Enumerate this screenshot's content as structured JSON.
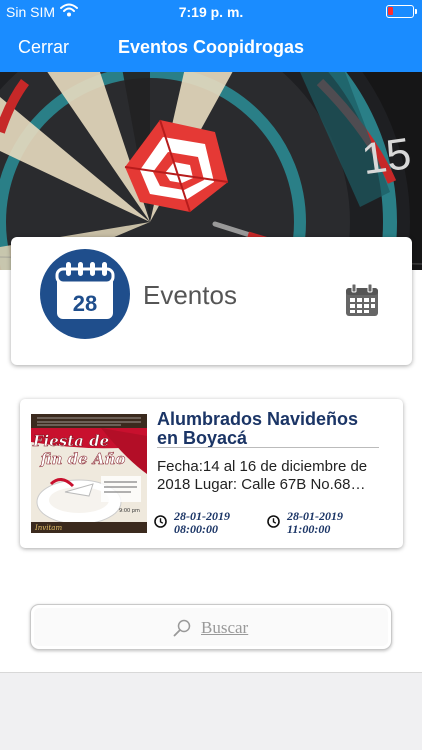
{
  "status_bar": {
    "carrier": "Sin SIM",
    "time": "7:19 p. m.",
    "wifi_icon": "wifi-icon",
    "battery_icon": "battery-low-icon",
    "battery_level": 0.15,
    "battery_color": "#ff2d2d"
  },
  "nav": {
    "close_label": "Cerrar",
    "title": "Eventos Coopidrogas",
    "color": "#1a8cff"
  },
  "hero": {
    "image": "darts-board-photo",
    "board_number": "15"
  },
  "header_card": {
    "icon_day": "28",
    "label": "Eventos",
    "calendar_icon": "calendar-icon"
  },
  "events": [
    {
      "title": "Alumbrados Navideños en Boyacá",
      "description": "Fecha:14 al 16 de diciembre de 2018 Lugar: Calle 67B No.68…",
      "thumb_title_line1": "Fiesta de",
      "thumb_title_line2": "fin de Año",
      "start_date": "28-01-2019",
      "start_time": "08:00:00",
      "end_date": "28-01-2019",
      "end_time": "11:00:00"
    }
  ],
  "search": {
    "label": "Buscar",
    "icon": "search-icon"
  }
}
